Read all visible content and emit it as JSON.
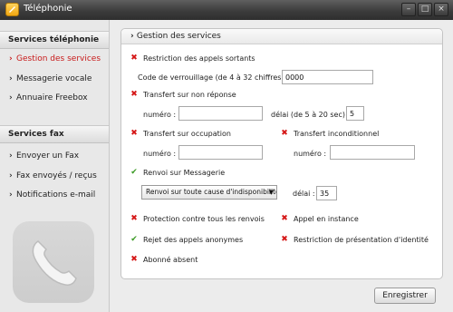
{
  "window": {
    "title": "Téléphonie"
  },
  "sidebar": {
    "sections": [
      {
        "title": "Services téléphonie",
        "items": [
          {
            "label": "Gestion des services",
            "active": true
          },
          {
            "label": "Messagerie vocale",
            "active": false
          },
          {
            "label": "Annuaire Freebox",
            "active": false
          }
        ]
      },
      {
        "title": "Services fax",
        "items": [
          {
            "label": "Envoyer un Fax",
            "active": false
          },
          {
            "label": "Fax envoyés / reçus",
            "active": false
          },
          {
            "label": "Notifications e-mail",
            "active": false
          }
        ]
      }
    ]
  },
  "panel": {
    "title": "Gestion des services",
    "restriction_sortants": {
      "label": "Restriction des appels sortants",
      "enabled": false,
      "code_label": "Code de verrouillage (de 4 à 32 chiffres) :",
      "code_value": "0000"
    },
    "transfert_non_reponse": {
      "label": "Transfert sur non réponse",
      "enabled": false,
      "numero_label": "numéro :",
      "numero_value": "",
      "delai_label": "délai (de 5 à 20 sec) :",
      "delai_value": "5"
    },
    "transfert_occupation": {
      "label": "Transfert sur occupation",
      "enabled": false,
      "numero_label": "numéro :",
      "numero_value": ""
    },
    "transfert_inconditionnel": {
      "label": "Transfert inconditionnel",
      "enabled": false,
      "numero_label": "numéro :",
      "numero_value": ""
    },
    "renvoi_messagerie": {
      "label": "Renvoi sur Messagerie",
      "enabled": true,
      "select_value": "Renvoi sur toute cause d'indisponibilité",
      "delai_label": "délai :",
      "delai_value": "35"
    },
    "protection_renvois": {
      "label": "Protection contre tous les renvois",
      "enabled": false
    },
    "appel_instance": {
      "label": "Appel en instance",
      "enabled": false
    },
    "rejet_anonymes": {
      "label": "Rejet des appels anonymes",
      "enabled": true
    },
    "restriction_identite": {
      "label": "Restriction de présentation d'identité",
      "enabled": false
    },
    "abonne_absent": {
      "label": "Abonné absent",
      "enabled": false
    }
  },
  "footer": {
    "save_label": "Enregistrer"
  },
  "icons": {
    "enabled": "check-icon",
    "disabled": "cross-icon"
  },
  "colors": {
    "enabled": "#3a9a24",
    "disabled": "#d51717",
    "active_nav": "#c81a1a"
  }
}
